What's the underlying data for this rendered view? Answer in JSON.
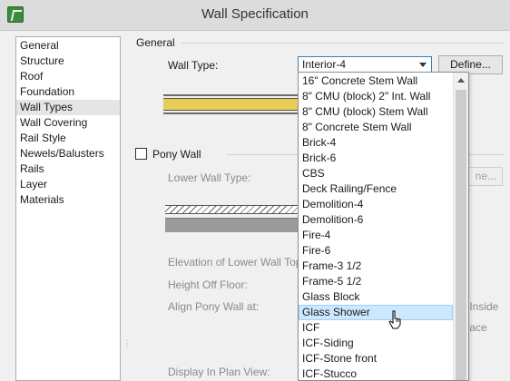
{
  "window": {
    "title": "Wall Specification"
  },
  "sidebar": {
    "items": [
      {
        "label": "General"
      },
      {
        "label": "Structure"
      },
      {
        "label": "Roof"
      },
      {
        "label": "Foundation"
      },
      {
        "label": "Wall Types",
        "selected": true
      },
      {
        "label": "Wall Covering"
      },
      {
        "label": "Rail Style"
      },
      {
        "label": "Newels/Balusters"
      },
      {
        "label": "Rails"
      },
      {
        "label": "Layer"
      },
      {
        "label": "Materials"
      }
    ]
  },
  "general": {
    "heading": "General",
    "wall_type_label": "Wall Type:",
    "wall_type_value": "Interior-4",
    "define_label": "Define..."
  },
  "pony": {
    "checkbox_label": "Pony Wall",
    "checked": false,
    "lower_wall_type_label": "Lower Wall Type:",
    "define_partial": "ne...",
    "elevation_label": "Elevation of Lower Wall Top:",
    "height_off_floor_label": "Height Off Floor:",
    "align_label": "Align Pony Wall at:",
    "align_option_inside": "r Inside",
    "align_option_face": "face",
    "display_label": "Display In Plan View:"
  },
  "dropdown": {
    "items": [
      "16\" Concrete Stem Wall",
      "8\" CMU (block) 2\" Int. Wall",
      "8\" CMU (block) Stem Wall",
      "8\" Concrete Stem Wall",
      "Brick-4",
      "Brick-6",
      "CBS",
      "Deck Railing/Fence",
      "Demolition-4",
      "Demolition-6",
      "Fire-4",
      "Fire-6",
      "Frame-3 1/2",
      "Frame-5 1/2",
      "Glass Block",
      "Glass Shower",
      "ICF",
      "ICF-Siding",
      "ICF-Stone front",
      "ICF-Stucco"
    ],
    "hover_index": 15
  },
  "colors": {
    "wall_fill": "#e6cd55",
    "hover_bg": "#cce8ff",
    "select_border": "#3c7fb1"
  }
}
